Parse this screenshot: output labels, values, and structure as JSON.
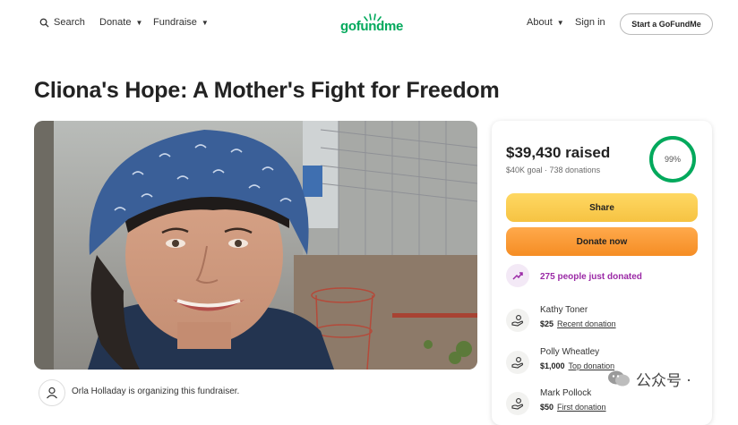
{
  "header": {
    "search_label": "Search",
    "donate_label": "Donate",
    "fundraise_label": "Fundraise",
    "logo_text": "gofundme",
    "about_label": "About",
    "signin_label": "Sign in",
    "start_label": "Start a GoFundMe",
    "brand_color": "#02a95c"
  },
  "page": {
    "title": "Cliona's Hope: A Mother's Fight for Freedom",
    "organizer_text": "Orla Holladay is organizing this fundraiser."
  },
  "card": {
    "raised": "$39,430 raised",
    "goal_line": "$40K goal · 738 donations",
    "progress_percent": 99,
    "progress_label": "99%",
    "share_label": "Share",
    "donate_now_label": "Donate now",
    "trending_text": "275 people just donated",
    "donations": [
      {
        "name": "Kathy Toner",
        "amount": "$25",
        "tag": "Recent donation"
      },
      {
        "name": "Polly Wheatley",
        "amount": "$1,000",
        "tag": "Top donation"
      },
      {
        "name": "Mark Pollock",
        "amount": "$50",
        "tag": "First donation"
      }
    ]
  },
  "watermark": {
    "text": "公众号 · "
  }
}
